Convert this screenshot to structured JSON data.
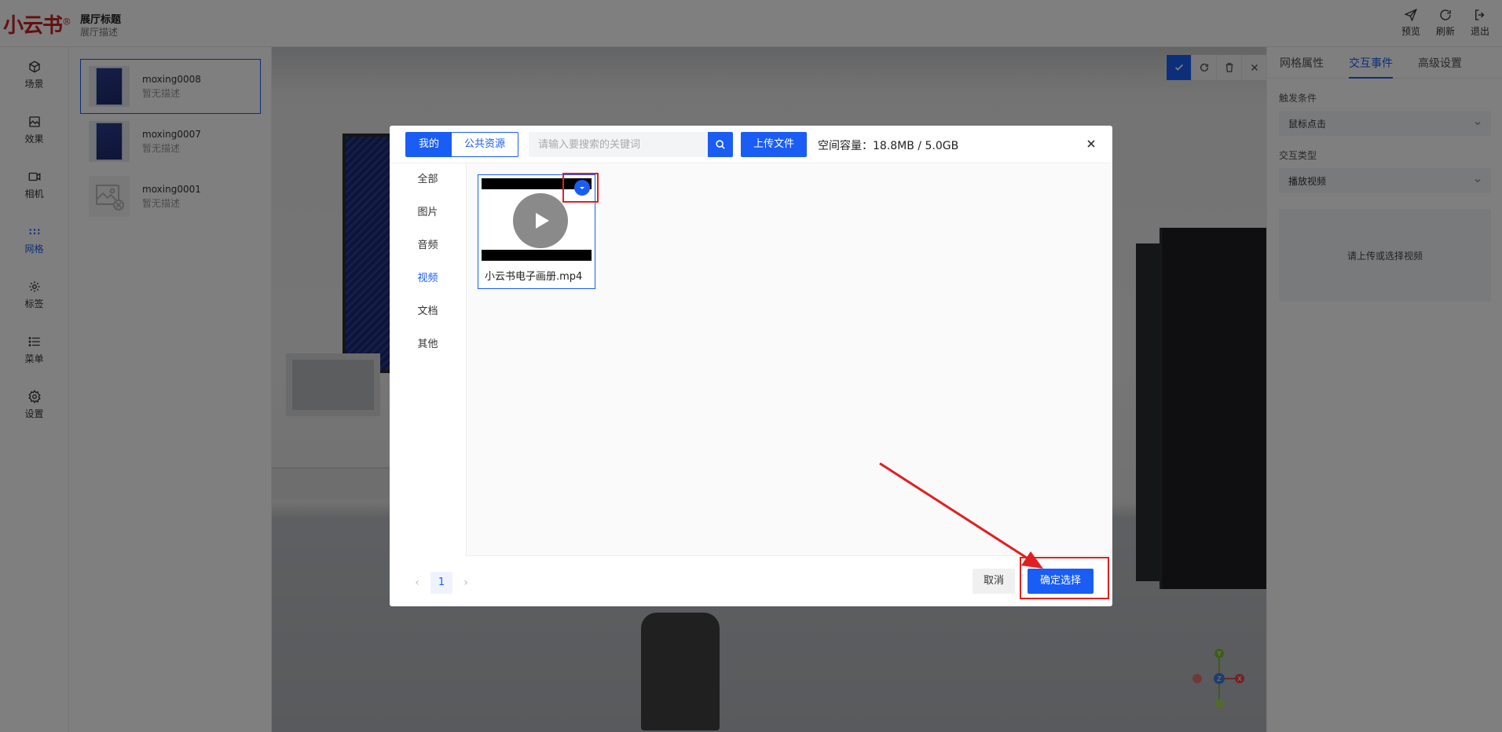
{
  "header": {
    "logo": "小云书",
    "logo_mark": "®",
    "hall_title": "展厅标题",
    "hall_desc": "展厅描述",
    "actions": [
      {
        "label": "预览",
        "icon": "send-icon"
      },
      {
        "label": "刷新",
        "icon": "refresh-icon"
      },
      {
        "label": "退出",
        "icon": "logout-icon"
      }
    ]
  },
  "leftnav": {
    "items": [
      {
        "label": "场景",
        "icon": "cube-icon",
        "active": false
      },
      {
        "label": "效果",
        "icon": "image-icon",
        "active": false
      },
      {
        "label": "相机",
        "icon": "camera-icon",
        "active": false
      },
      {
        "label": "网格",
        "icon": "grid-dots-icon",
        "active": true
      },
      {
        "label": "标签",
        "icon": "tag-icon",
        "active": false
      },
      {
        "label": "菜单",
        "icon": "menu-list-icon",
        "active": false
      },
      {
        "label": "设置",
        "icon": "gear-icon",
        "active": false
      }
    ]
  },
  "models": [
    {
      "name": "moxing0008",
      "desc": "暂无描述",
      "selected": true
    },
    {
      "name": "moxing0007",
      "desc": "暂无描述",
      "selected": false
    },
    {
      "name": "moxing0001",
      "desc": "暂无描述",
      "selected": false
    }
  ],
  "right_panel": {
    "tabs": [
      {
        "label": "网格属性",
        "active": false
      },
      {
        "label": "交互事件",
        "active": true
      },
      {
        "label": "高级设置",
        "active": false
      }
    ],
    "trigger_label": "触发条件",
    "trigger_value": "鼠标点击",
    "interaction_label": "交互类型",
    "interaction_value": "播放视频",
    "upload_hint": "请上传或选择视频"
  },
  "modal": {
    "tabs": [
      {
        "label": "我的",
        "active": true
      },
      {
        "label": "公共资源",
        "active": false
      }
    ],
    "search_placeholder": "请输入要搜索的关键词",
    "upload_label": "上传文件",
    "capacity_text": "空间容量：18.8MB / 5.0GB",
    "categories": [
      {
        "label": "全部",
        "active": false
      },
      {
        "label": "图片",
        "active": false
      },
      {
        "label": "音频",
        "active": false
      },
      {
        "label": "视频",
        "active": true
      },
      {
        "label": "文档",
        "active": false
      },
      {
        "label": "其他",
        "active": false
      }
    ],
    "files": [
      {
        "name": "小云书电子画册.mp4",
        "selected": true
      }
    ],
    "pagination": {
      "current": "1",
      "prev": "‹",
      "next": "›"
    },
    "cancel_label": "取消",
    "confirm_label": "确定选择"
  },
  "colors": {
    "accent": "#1a5df5",
    "highlight": "#e02020",
    "brand": "#c81f1f"
  }
}
